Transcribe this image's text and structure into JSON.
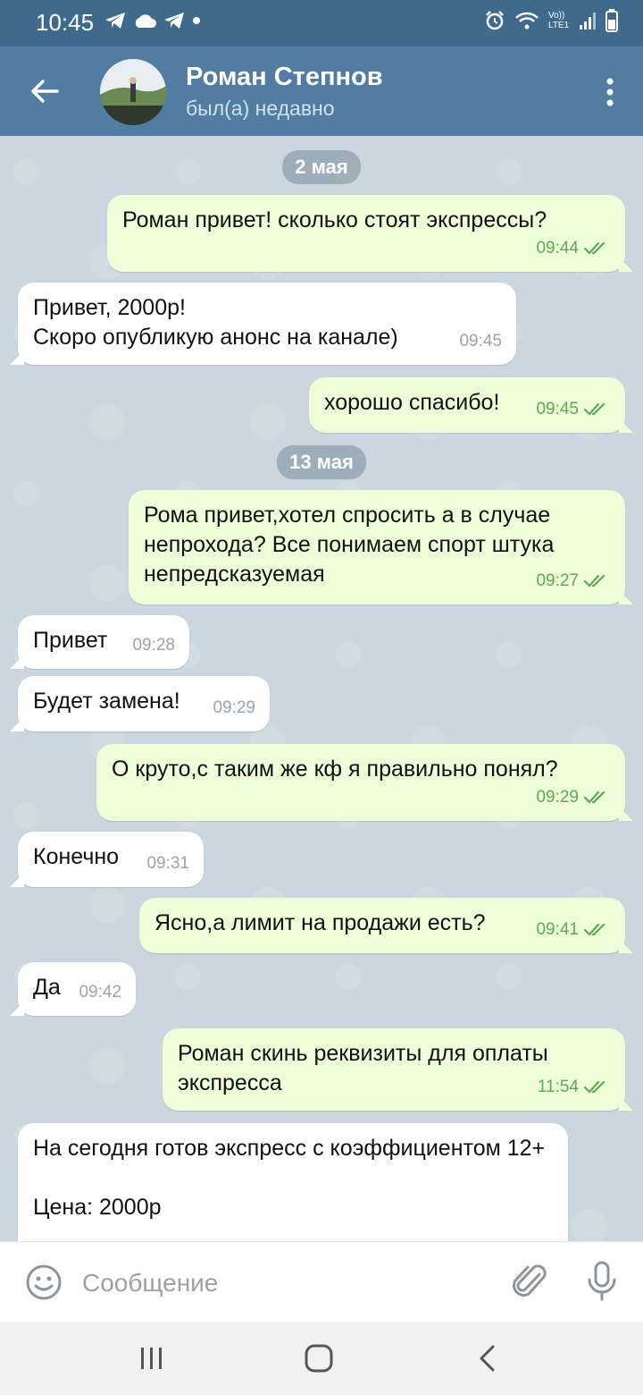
{
  "status_bar": {
    "time": "10:45",
    "network_label": "Vo)) LTE1"
  },
  "header": {
    "name": "Роман Степнов",
    "status": "был(а) недавно"
  },
  "dates": [
    "2 мая",
    "13 мая"
  ],
  "messages": [
    {
      "dir": "out",
      "text": "Роман привет! сколько стоят экспрессы?",
      "time": "09:44"
    },
    {
      "dir": "in",
      "text": "Привет, 2000р!\nСкоро опубликую анонс на канале)",
      "time": "09:45"
    },
    {
      "dir": "out",
      "text": "хорошо спасибо!",
      "time": "09:45"
    },
    {
      "dir": "out",
      "text": "Рома привет,хотел спросить а в случае непрохода? Все понимаем спорт штука непредсказуемая",
      "time": "09:27"
    },
    {
      "dir": "in",
      "text": "Привет",
      "time": "09:28"
    },
    {
      "dir": "in",
      "text": "Будет замена!",
      "time": "09:29"
    },
    {
      "dir": "out",
      "text": "О круто,с таким же кф я правильно понял?",
      "time": "09:29"
    },
    {
      "dir": "in",
      "text": "Конечно",
      "time": "09:31"
    },
    {
      "dir": "out",
      "text": "Ясно,а лимит на продажи есть?",
      "time": "09:41"
    },
    {
      "dir": "in",
      "text": "Да",
      "time": "09:42"
    },
    {
      "dir": "out",
      "text": "Роман скинь реквизиты для оплаты экспресса",
      "time": "11:54"
    },
    {
      "dir": "in",
      "text": "На сегодня готов экспресс с коэффициентом 12+\n\nЦена: 2000р",
      "time": ""
    }
  ],
  "input": {
    "placeholder": "Сообщение"
  },
  "colors": {
    "header": "#517da2",
    "status_bar": "#3f6a8e",
    "outgoing_bubble": "#eefed9",
    "incoming_bubble": "#ffffff",
    "read_check": "#5da954"
  }
}
